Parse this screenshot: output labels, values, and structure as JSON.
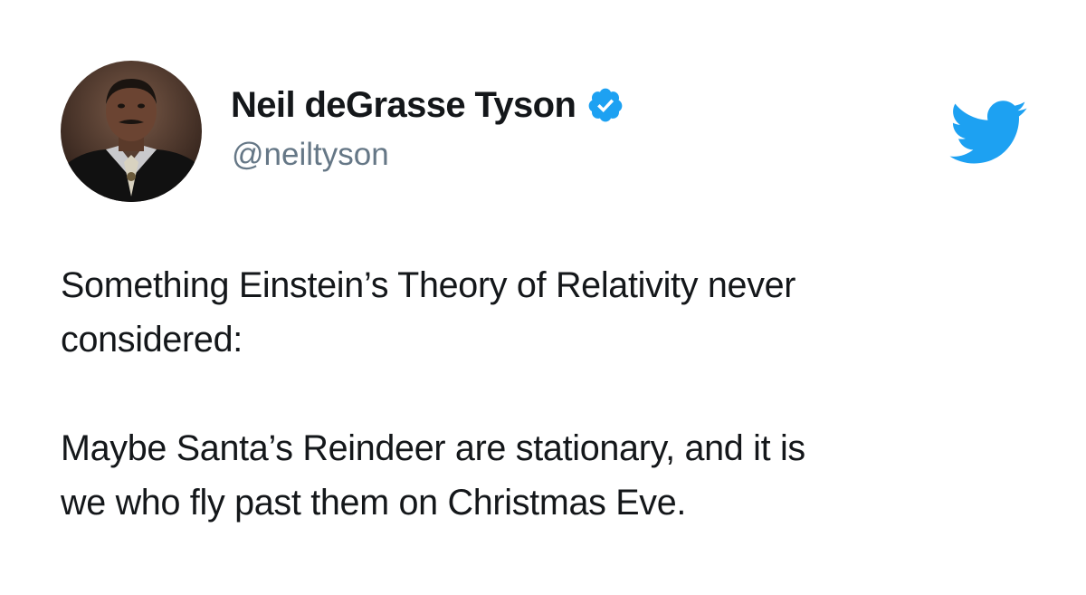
{
  "author": {
    "display_name": "Neil deGrasse Tyson",
    "handle": "@neiltyson",
    "verified": true,
    "avatar_icon": "profile-photo"
  },
  "tweet": {
    "paragraph_1_line_1": "Something Einstein’s Theory of Relativity never",
    "paragraph_1_line_2": "considered:",
    "paragraph_2_line_1": "Maybe Santa’s Reindeer are stationary, and it is",
    "paragraph_2_line_2": "we who fly past them on Christmas Eve."
  },
  "icons": {
    "verified_badge": "verified-badge-icon",
    "brand_logo": "twitter-bird-icon"
  },
  "colors": {
    "brand_blue": "#1da1f2",
    "name_text": "#14171a",
    "handle_text": "#657786",
    "background": "#ffffff"
  }
}
